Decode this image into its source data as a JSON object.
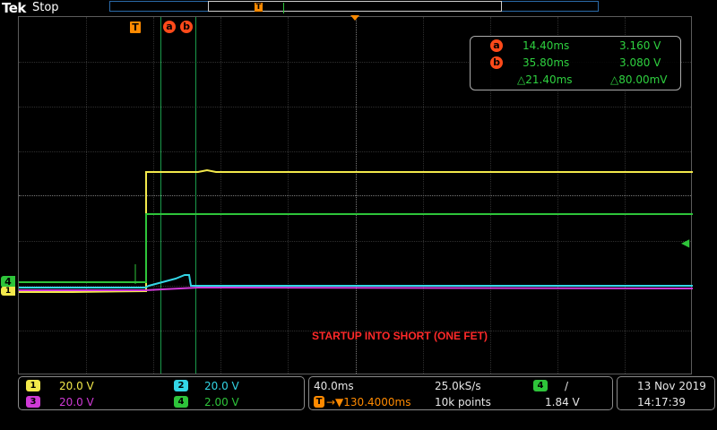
{
  "app": {
    "logo": "Tek",
    "state": "Stop"
  },
  "markers": {
    "trigger": "T",
    "cursor_a": "a",
    "cursor_b": "b",
    "ch4_marker": "4",
    "ch1_marker": "1"
  },
  "cursor_readout": {
    "a_label": "a",
    "a_time": "14.40ms",
    "a_value": "3.160 V",
    "b_label": "b",
    "b_time": "35.80ms",
    "b_value": "3.080 V",
    "delta_time": "△21.40ms",
    "delta_value": "△80.00mV"
  },
  "annotation": "STARTUP INTO SHORT (ONE FET)",
  "channels": [
    {
      "num": "1",
      "scale": "20.0 V",
      "color": "#f3e94b"
    },
    {
      "num": "2",
      "scale": "20.0 V",
      "color": "#33d6e6"
    },
    {
      "num": "3",
      "scale": "20.0 V",
      "color": "#d03ad6"
    },
    {
      "num": "4",
      "scale": "2.00 V",
      "color": "#2ec43a"
    }
  ],
  "timebase": {
    "horizontal_scale": "40.0ms",
    "sample_rate": "25.0kS/s",
    "trigger_position": "→▼130.4000ms",
    "record_length": "10k points",
    "trigger_source": "4",
    "trigger_slope": "/",
    "trigger_level": "1.84 V"
  },
  "datetime": {
    "date": "13 Nov 2019",
    "time": "14:17:39"
  }
}
